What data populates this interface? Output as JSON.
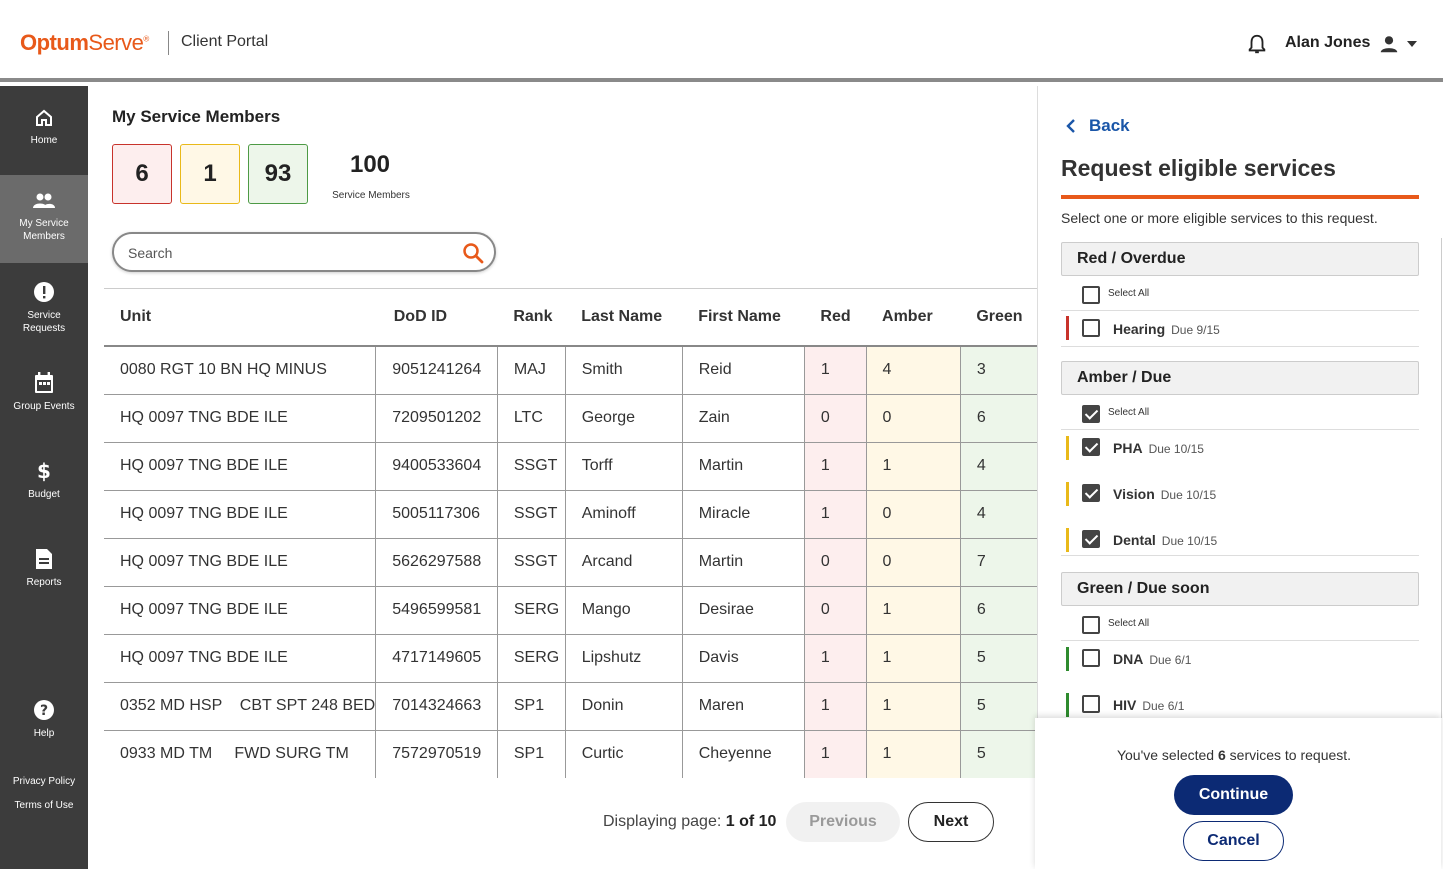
{
  "header": {
    "logo_main": "Optum",
    "logo_sub": "Serve",
    "portal_name": "Client Portal",
    "user_name": "Alan Jones",
    "icons": [
      "bell-icon",
      "user-icon",
      "caret-down-icon"
    ]
  },
  "sidebar": {
    "items": [
      {
        "label": "Home",
        "icon": "home-icon"
      },
      {
        "label": "My Service Members",
        "icon": "people-icon",
        "active": true
      },
      {
        "label": "Service Requests",
        "icon": "alert-icon"
      },
      {
        "label": "Group Events",
        "icon": "calendar-icon"
      },
      {
        "label": "Budget",
        "icon": "dollar-icon"
      },
      {
        "label": "Reports",
        "icon": "document-icon"
      },
      {
        "label": "Help",
        "icon": "help-icon"
      }
    ],
    "footer": {
      "privacy": "Privacy Policy",
      "terms": "Terms of Use"
    }
  },
  "main": {
    "title": "My Service Members",
    "counts": {
      "red": "6",
      "amber": "1",
      "green": "93"
    },
    "total": {
      "value": "100",
      "label": "Service Members"
    },
    "search": {
      "placeholder": "Search"
    },
    "table": {
      "columns": [
        "Unit",
        "DoD ID",
        "Rank",
        "Last Name",
        "First Name",
        "Red",
        "Amber",
        "Green"
      ],
      "rows": [
        [
          "0080 RGT 10 BN HQ MINUS",
          "9051241264",
          "MAJ",
          "Smith",
          "Reid",
          "1",
          "4",
          "3"
        ],
        [
          "HQ 0097 TNG BDE ILE",
          "7209501202",
          "LTC",
          "George",
          "Zain",
          "0",
          "0",
          "6"
        ],
        [
          "HQ 0097 TNG BDE ILE",
          "9400533604",
          "SSGT",
          "Torff",
          "Martin",
          "1",
          "1",
          "4"
        ],
        [
          "HQ 0097 TNG BDE ILE",
          "5005117306",
          "SSGT",
          "Aminoff",
          "Miracle",
          "1",
          "0",
          "4"
        ],
        [
          "HQ 0097 TNG BDE ILE",
          "5626297588",
          "SSGT",
          "Arcand",
          "Martin",
          "0",
          "0",
          "7"
        ],
        [
          "HQ 0097 TNG BDE ILE",
          "5496599581",
          "SERG",
          "Mango",
          "Desirae",
          "0",
          "1",
          "6"
        ],
        [
          "HQ 0097 TNG BDE ILE",
          "4717149605",
          "SERG",
          "Lipshutz",
          "Davis",
          "1",
          "1",
          "5"
        ],
        [
          "0352 MD HSP    CBT SPT 248 BED",
          "7014324663",
          "SP1",
          "Donin",
          "Maren",
          "1",
          "1",
          "5"
        ],
        [
          "0933 MD TM     FWD SURG TM",
          "7572970519",
          "SP1",
          "Curtic",
          "Cheyenne",
          "1",
          "1",
          "5"
        ]
      ]
    },
    "pager": {
      "prefix": "Displaying page:",
      "current": "1 of 10",
      "previous": "Previous",
      "next": "Next"
    }
  },
  "panel": {
    "back": "Back",
    "title": "Request eligible services",
    "subtitle": "Select one or more eligible services to this request.",
    "select_all": "Select All",
    "groups": [
      {
        "name": "Red / Overdue",
        "color": "#c8332b",
        "select_all_checked": false,
        "services": [
          {
            "name": "Hearing",
            "due": "Due 9/15",
            "checked": false
          }
        ]
      },
      {
        "name": "Amber / Due",
        "color": "#e9b919",
        "select_all_checked": true,
        "services": [
          {
            "name": "PHA",
            "due": "Due 10/15",
            "checked": true
          },
          {
            "name": "Vision",
            "due": "Due 10/15",
            "checked": true
          },
          {
            "name": "Dental",
            "due": "Due 10/15",
            "checked": true
          }
        ]
      },
      {
        "name": "Green / Due soon",
        "color": "#2e8b2e",
        "select_all_checked": false,
        "services": [
          {
            "name": "DNA",
            "due": "Due 6/1",
            "checked": false
          },
          {
            "name": "HIV",
            "due": "Due 6/1",
            "checked": false
          }
        ]
      }
    ],
    "footer": {
      "selected_prefix": "You've selected",
      "selected_count": "6",
      "selected_suffix": "services to request.",
      "continue": "Continue",
      "cancel": "Cancel"
    }
  }
}
